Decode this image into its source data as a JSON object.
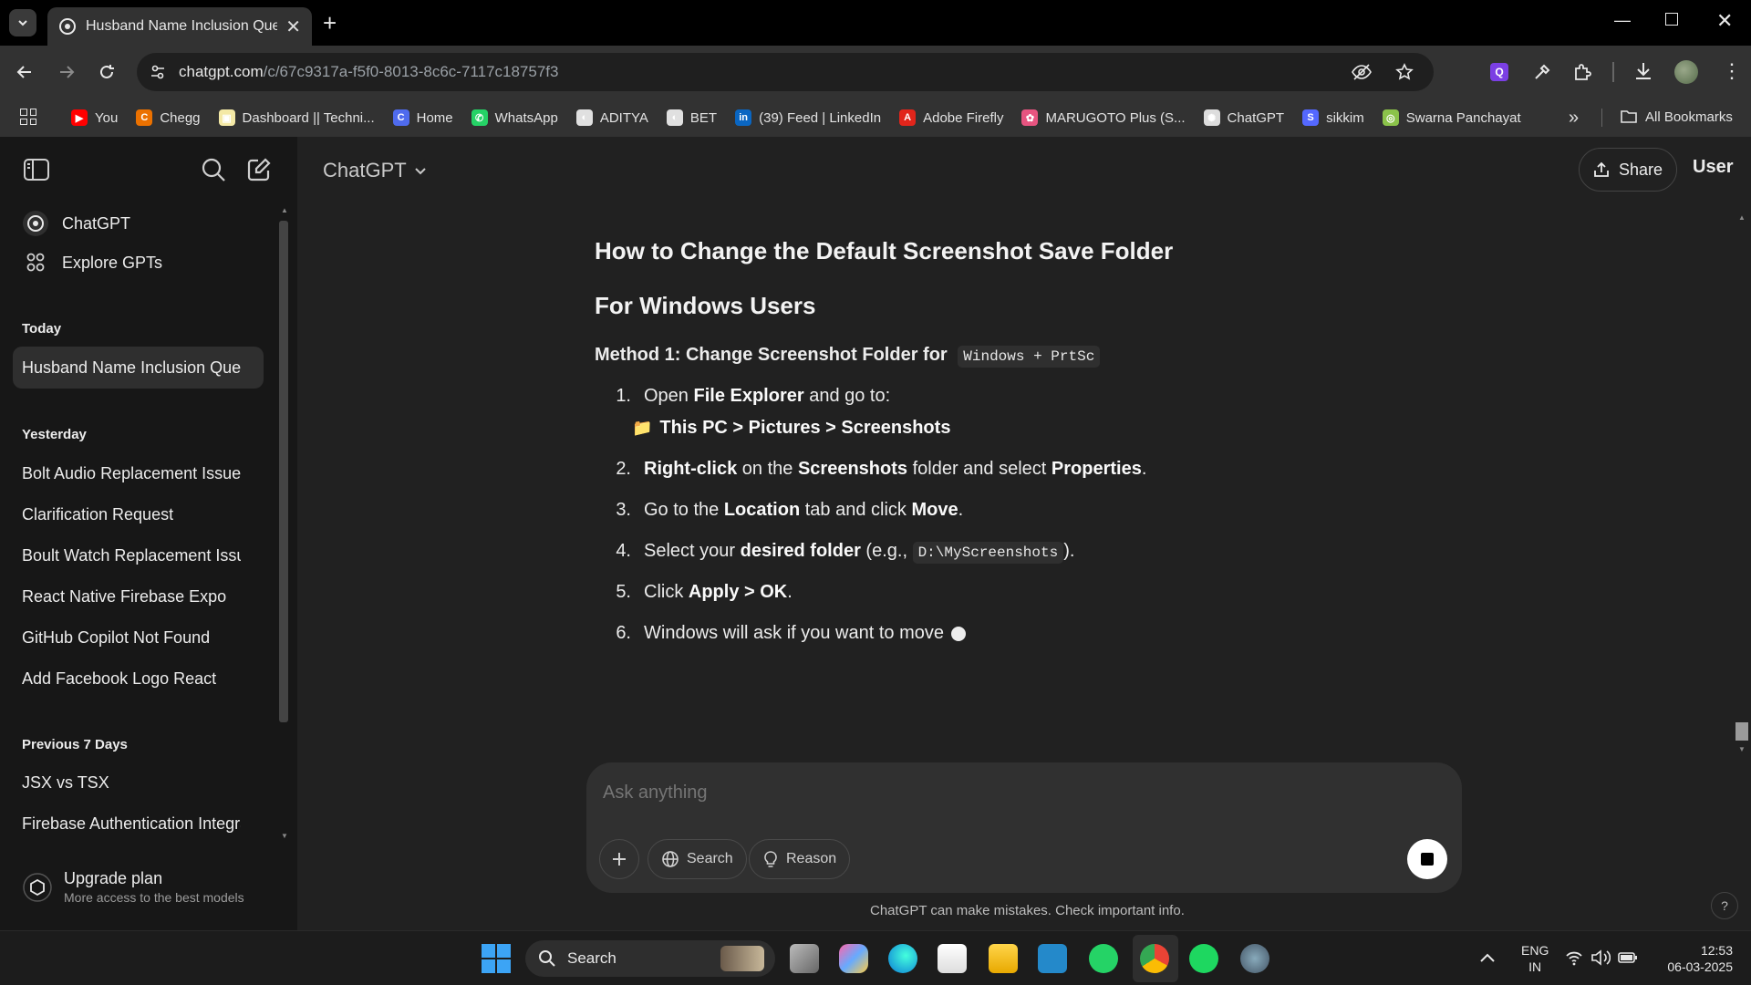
{
  "browser": {
    "tab_title": "Husband Name Inclusion Query",
    "url_host": "chatgpt.com",
    "url_path": "/c/67c9317a-f5f0-8013-8c6c-7117c18757f3",
    "bookmarks": [
      {
        "label": "You",
        "color": "#ff0000",
        "glyph": "▶"
      },
      {
        "label": "Chegg",
        "color": "#eb7100",
        "glyph": "C"
      },
      {
        "label": "Dashboard || Techni...",
        "color": "#f4e9a6",
        "glyph": "▣"
      },
      {
        "label": "Home",
        "color": "#4f6bed",
        "glyph": "C"
      },
      {
        "label": "WhatsApp",
        "color": "#25d366",
        "glyph": "✆"
      },
      {
        "label": "ADITYA",
        "color": "#e0e0e0",
        "glyph": "◐"
      },
      {
        "label": "BET",
        "color": "#e0e0e0",
        "glyph": "◐"
      },
      {
        "label": "(39) Feed | LinkedIn",
        "color": "#0a66c2",
        "glyph": "in"
      },
      {
        "label": "Adobe Firefly",
        "color": "#e1251b",
        "glyph": "A"
      },
      {
        "label": "MARUGOTO Plus (S...",
        "color": "#e75480",
        "glyph": "✿"
      },
      {
        "label": "ChatGPT",
        "color": "#dddddd",
        "glyph": "✺"
      },
      {
        "label": "sikkim",
        "color": "#5468ff",
        "glyph": "S"
      },
      {
        "label": "Swarna Panchayat",
        "color": "#8bc34a",
        "glyph": "◎"
      }
    ],
    "more_bookmarks": "»",
    "all_bookmarks": "All Bookmarks"
  },
  "sidebar": {
    "top_items": [
      {
        "label": "ChatGPT",
        "icon": "openai-logo-icon"
      },
      {
        "label": "Explore GPTs",
        "icon": "grid-icon"
      }
    ],
    "sections": [
      {
        "heading": "Today",
        "items": [
          "Husband Name Inclusion Query"
        ]
      },
      {
        "heading": "Yesterday",
        "items": [
          "Bolt Audio Replacement Issue",
          "Clarification Request",
          "Boult Watch Replacement Issue",
          "React Native Firebase Expo",
          "GitHub Copilot Not Found",
          "Add Facebook Logo React"
        ]
      },
      {
        "heading": "Previous 7 Days",
        "items": [
          "JSX vs TSX",
          "Firebase Authentication Integration"
        ]
      }
    ],
    "upgrade": {
      "title": "Upgrade plan",
      "subtitle": "More access to the best models"
    }
  },
  "header": {
    "model_label": "ChatGPT",
    "share_label": "Share",
    "user_label": "User"
  },
  "message": {
    "h_main": "How to Change the Default Screenshot Save Folder",
    "h_sub": "For Windows Users",
    "method_prefix": "Method 1: Change Screenshot Folder for",
    "method_code": "Windows + PrtSc",
    "s1": {
      "num": "1.",
      "a": "Open ",
      "b": "File Explorer",
      "c": " and go to:"
    },
    "s1_path": {
      "folder": "📁",
      "text": "This PC > Pictures > Screenshots"
    },
    "s2": {
      "num": "2.",
      "a": "Right-click",
      "b": " on the ",
      "c": "Screenshots",
      "d": " folder and select ",
      "e": "Properties",
      "f": "."
    },
    "s3": {
      "num": "3.",
      "a": "Go to the ",
      "b": "Location",
      "c": " tab and click ",
      "d": "Move",
      "e": "."
    },
    "s4": {
      "num": "4.",
      "a": "Select your ",
      "b": "desired folder",
      "c": " (e.g., ",
      "code": "D:\\MyScreenshots",
      "d": ")."
    },
    "s5": {
      "num": "5.",
      "a": "Click ",
      "b": "Apply > OK",
      "c": "."
    },
    "s6": {
      "num": "6.",
      "a": "Windows will ask if you want to move"
    }
  },
  "composer": {
    "placeholder": "Ask anything",
    "search_label": "Search",
    "reason_label": "Reason"
  },
  "footer_note": "ChatGPT can make mistakes. Check important info.",
  "help_label": "?",
  "taskbar": {
    "search_label": "Search",
    "lang_top": "ENG",
    "lang_bottom": "IN",
    "time": "12:53",
    "date": "06-03-2025"
  }
}
